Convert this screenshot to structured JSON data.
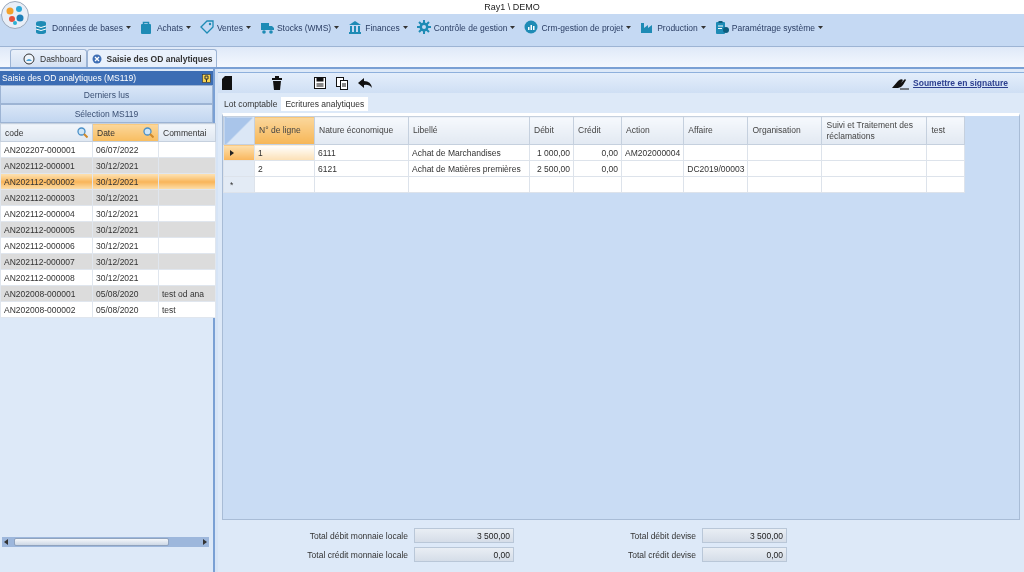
{
  "window": {
    "title": "Ray1 \\ DEMO"
  },
  "menu": [
    {
      "label": "Données de bases",
      "kind": "database"
    },
    {
      "label": "Achats",
      "kind": "bag"
    },
    {
      "label": "Ventes",
      "kind": "tag"
    },
    {
      "label": "Stocks (WMS)",
      "kind": "truck"
    },
    {
      "label": "Finances",
      "kind": "bank"
    },
    {
      "label": "Contrôle de gestion",
      "kind": "gear"
    },
    {
      "label": "Crm-gestion de projet",
      "kind": "chart"
    },
    {
      "label": "Production",
      "kind": "factory"
    },
    {
      "label": "Paramétrage système",
      "kind": "clipboard"
    }
  ],
  "tabs": [
    {
      "label": "Dashboard",
      "selected": false
    },
    {
      "label": "Saisie des OD analytiques",
      "selected": true
    }
  ],
  "side_panel": {
    "title": "Saisie des OD analytiques (MS119)",
    "buttons": [
      "Derniers lus",
      "Sélection MS119"
    ],
    "columns": [
      {
        "label": "code",
        "selected": false,
        "searchable": true
      },
      {
        "label": "Date",
        "selected": true,
        "searchable": true
      },
      {
        "label": "Commentai",
        "selected": false,
        "searchable": false
      }
    ],
    "rows": [
      {
        "cells": [
          "AN202207-000001",
          "06/07/2022",
          ""
        ],
        "selected": false
      },
      {
        "cells": [
          "AN202112-000001",
          "30/12/2021",
          ""
        ],
        "selected": false
      },
      {
        "cells": [
          "AN202112-000002",
          "30/12/2021",
          ""
        ],
        "selected": true
      },
      {
        "cells": [
          "AN202112-000003",
          "30/12/2021",
          ""
        ],
        "selected": false
      },
      {
        "cells": [
          "AN202112-000004",
          "30/12/2021",
          ""
        ],
        "selected": false
      },
      {
        "cells": [
          "AN202112-000005",
          "30/12/2021",
          ""
        ],
        "selected": false
      },
      {
        "cells": [
          "AN202112-000006",
          "30/12/2021",
          ""
        ],
        "selected": false
      },
      {
        "cells": [
          "AN202112-000007",
          "30/12/2021",
          ""
        ],
        "selected": false
      },
      {
        "cells": [
          "AN202112-000008",
          "30/12/2021",
          ""
        ],
        "selected": false
      },
      {
        "cells": [
          "AN202008-000001",
          "05/08/2020",
          "test od ana"
        ],
        "selected": false
      },
      {
        "cells": [
          "AN202008-000002",
          "05/08/2020",
          "test"
        ],
        "selected": false
      }
    ]
  },
  "main": {
    "signature_link": "Soumettre en signature",
    "subtabs": [
      {
        "label": "Lot comptable",
        "selected": false
      },
      {
        "label": "Ecritures analytiques",
        "selected": true
      }
    ],
    "columns": [
      {
        "label": "N° de ligne",
        "kind": "text",
        "selected": true
      },
      {
        "label": "Nature économique",
        "kind": "text",
        "selected": false
      },
      {
        "label": "Libellé",
        "kind": "text",
        "selected": false
      },
      {
        "label": "Débit",
        "kind": "number",
        "selected": false
      },
      {
        "label": "Crédit",
        "kind": "number",
        "selected": false
      },
      {
        "label": "Action",
        "kind": "text",
        "selected": false
      },
      {
        "label": "Affaire",
        "kind": "text",
        "selected": false
      },
      {
        "label": "Organisation",
        "kind": "text",
        "selected": false
      },
      {
        "label": "Suivi et Traitement des réclamations",
        "kind": "text",
        "selected": false
      },
      {
        "label": "test",
        "kind": "text",
        "selected": false
      }
    ],
    "rows": [
      {
        "cells": [
          "1",
          "6111",
          "Achat de Marchandises",
          "1 000,00",
          "0,00",
          "AM202000004",
          "",
          "",
          "",
          ""
        ],
        "selected": true
      },
      {
        "cells": [
          "2",
          "6121",
          "Achat de Matières premières",
          "2 500,00",
          "0,00",
          "",
          "DC2019/00003",
          "",
          "",
          ""
        ],
        "selected": false
      }
    ],
    "new_row_marker": "*",
    "totals": [
      {
        "label": "Total débit monnaie locale",
        "value": "3 500,00"
      },
      {
        "label": "Total débit devise",
        "value": "3 500,00"
      },
      {
        "label": "Total crédit monnaie locale",
        "value": "0,00"
      },
      {
        "label": "Total crédit devise",
        "value": "0,00"
      }
    ]
  }
}
